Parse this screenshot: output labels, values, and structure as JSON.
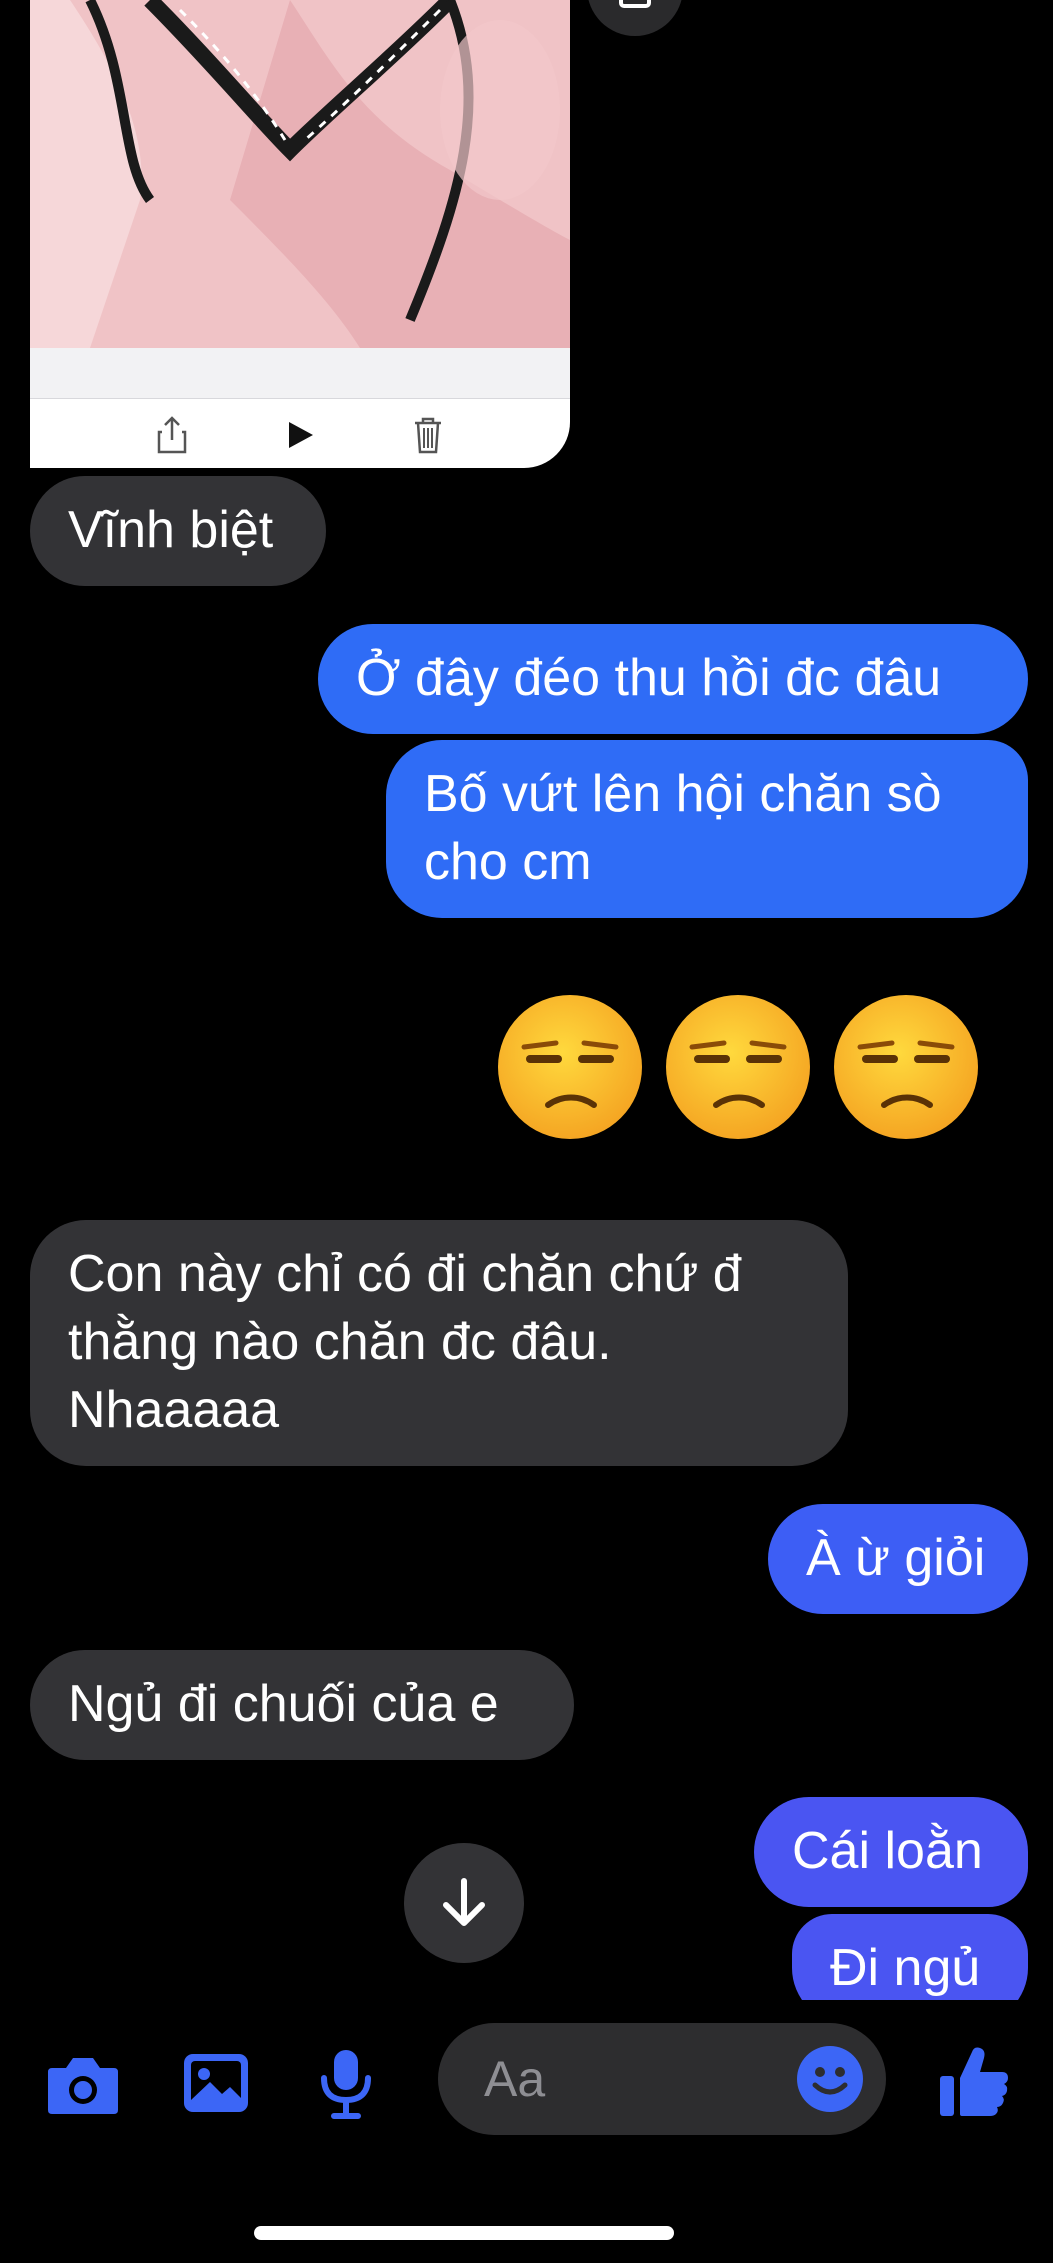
{
  "messages": {
    "m1": "Vĩnh biệt",
    "m2": "Ở đây đéo thu hồi đc đâu",
    "m3": "Bố vứt lên hội chăn sò cho cm",
    "m4": "😒😒😒",
    "m5": "Con này chỉ có đi chăn chứ đ thằng nào chăn đc đâu. Nhaaaaa",
    "m6": "À ừ giỏi",
    "m7": "Ngủ đi chuối của e",
    "m8": "Cái loằn",
    "m9": "Đi ngủ"
  },
  "composer": {
    "placeholder": "Aa"
  },
  "icons": {
    "camera": "camera-icon",
    "gallery": "image-icon",
    "mic": "microphone-icon",
    "emoji": "smile-icon",
    "like": "thumbs-up-icon",
    "share": "share-icon",
    "play": "play-icon",
    "trash": "trash-icon",
    "scroll": "arrow-down-icon"
  },
  "colors": {
    "accent": "#3d5ef5",
    "incoming_bubble": "#333336",
    "outgoing_bubble_top": "#2f6cf6",
    "outgoing_bubble_bottom": "#4a55f2",
    "background": "#000000"
  }
}
